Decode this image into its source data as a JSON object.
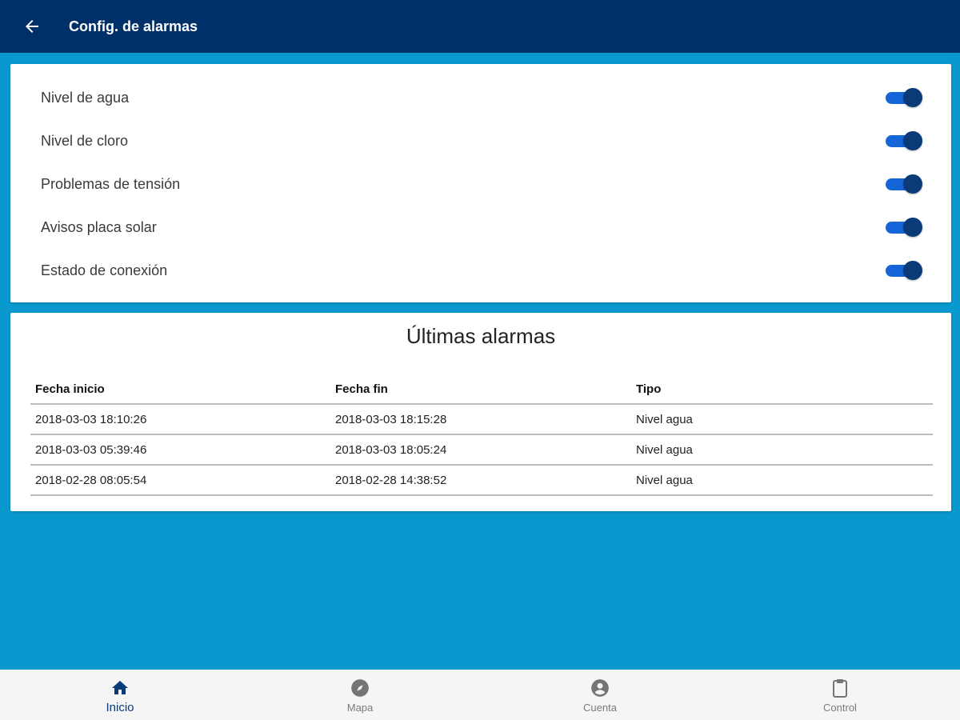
{
  "header": {
    "back_icon": "arrow-left-icon",
    "title": "Config. de alarmas"
  },
  "settings": {
    "items": [
      {
        "label": "Nivel de agua",
        "enabled": true
      },
      {
        "label": "Nivel de cloro",
        "enabled": true
      },
      {
        "label": "Problemas de tensión",
        "enabled": true
      },
      {
        "label": "Avisos placa solar",
        "enabled": true
      },
      {
        "label": "Estado de conexión",
        "enabled": true
      }
    ]
  },
  "alarms": {
    "title": "Últimas alarmas",
    "columns": [
      "Fecha inicio",
      "Fecha fin",
      "Tipo"
    ],
    "rows": [
      [
        "2018-03-03 18:10:26",
        "2018-03-03 18:15:28",
        "Nivel agua"
      ],
      [
        "2018-03-03 05:39:46",
        "2018-03-03 18:05:24",
        "Nivel agua"
      ],
      [
        "2018-02-28 08:05:54",
        "2018-02-28 14:38:52",
        "Nivel agua"
      ]
    ]
  },
  "bottom_nav": {
    "items": [
      {
        "label": "Inicio",
        "icon": "home-icon",
        "active": true
      },
      {
        "label": "Mapa",
        "icon": "compass-icon",
        "active": false
      },
      {
        "label": "Cuenta",
        "icon": "account-icon",
        "active": false
      },
      {
        "label": "Control",
        "icon": "clipboard-icon",
        "active": false
      }
    ]
  },
  "colors": {
    "primary_dark": "#00306a",
    "background": "#0a99cf",
    "toggle_track": "#1565d8",
    "toggle_thumb": "#0b3a78"
  }
}
